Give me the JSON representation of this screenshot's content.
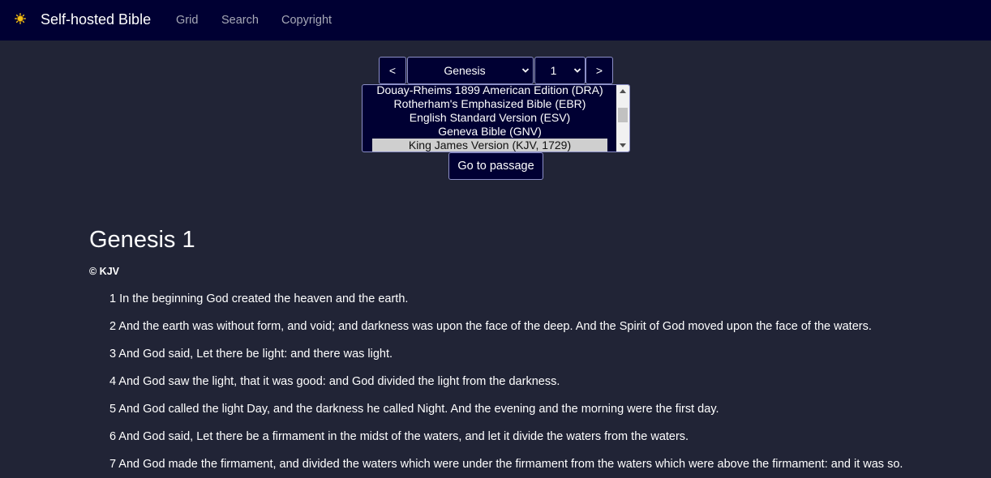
{
  "header": {
    "logo_icon": "sun-icon",
    "brand": "Self-hosted Bible",
    "nav": [
      {
        "label": "Grid"
      },
      {
        "label": "Search"
      },
      {
        "label": "Copyright"
      }
    ],
    "background_color": "#000033"
  },
  "passage_selector": {
    "prev_label": "<",
    "next_label": ">",
    "book": "Genesis",
    "chapter": "1",
    "versions": [
      "Douay-Rheims 1899 American Edition (DRA)",
      "Rotherham's Emphasized Bible (EBR)",
      "English Standard Version (ESV)",
      "Geneva Bible (GNV)",
      "King James Version (KJV, 1729)"
    ],
    "selected_version": "King James Version (KJV, 1729)",
    "go_label": "Go to passage"
  },
  "chapter": {
    "title": "Genesis 1",
    "copyright": "© KJV",
    "verses": [
      "1 In the beginning God created the heaven and the earth.",
      "2 And the earth was without form, and void; and darkness was upon the face of the deep. And the Spirit of God moved upon the face of the waters.",
      "3 And God said, Let there be light: and there was light.",
      "4 And God saw the light, that it was good: and God divided the light from the darkness.",
      "5 And God called the light Day, and the darkness he called Night. And the evening and the morning were the first day.",
      "6 And God said, Let there be a firmament in the midst of the waters, and let it divide the waters from the waters.",
      "7 And God made the firmament, and divided the waters which were under the firmament from the waters which were above the firmament: and it was so."
    ]
  },
  "colors": {
    "page_background": "#212436",
    "control_background": "#000033",
    "control_border": "#8c8fc6",
    "selected_option": "#cfcfcf"
  }
}
